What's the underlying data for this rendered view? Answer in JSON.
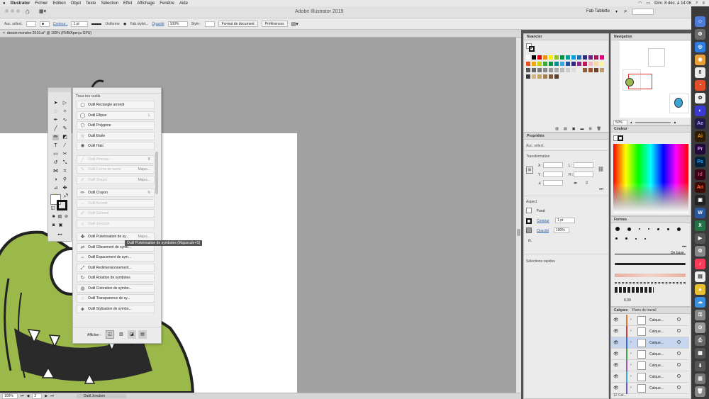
{
  "menubar": {
    "app": "Illustrator",
    "items": [
      "Fichier",
      "Edition",
      "Objet",
      "Texte",
      "Sélection",
      "Effet",
      "Affichage",
      "Fenêtre",
      "Aide"
    ],
    "datetime": "Dim. 8 déc. à 14:06"
  },
  "appbar": {
    "title": "Adobe Illustrator 2019",
    "workspace": "Fab Tablette"
  },
  "controlbar": {
    "selection_label": "Auc. sélect.",
    "stroke_label": "Contour :",
    "stroke_value": "1 pt",
    "stroke_profile": "Uniforme",
    "brush": "Fab.stylet...",
    "opacity_label": "Opacité",
    "opacity_value": "100%",
    "style_label": "Style :",
    "doc_format_btn": "Format de document",
    "prefs_btn": "Préférences"
  },
  "document": {
    "tab_title": "dessin-monstre-2019.ai* @ 100% (RVB/Aperçu GPU)"
  },
  "statusbar": {
    "zoom": "100%",
    "artboard": "2",
    "tool": "Outil Jonction"
  },
  "alltools": {
    "title": "Tous les outils",
    "items": [
      {
        "label": "Outil Rectangle arrondi",
        "shortcut": "",
        "icon": "rounded-rect",
        "dim": false
      },
      {
        "label": "Outil Ellipse",
        "shortcut": "L",
        "icon": "ellipse",
        "dim": false
      },
      {
        "label": "Outil Polygone",
        "shortcut": "",
        "icon": "polygon",
        "dim": false
      },
      {
        "label": "Outil Etoile",
        "shortcut": "",
        "icon": "star",
        "dim": false
      },
      {
        "label": "Outil Halo",
        "shortcut": "",
        "icon": "flare",
        "dim": false
      },
      {
        "label": "Outil Pinceau",
        "shortcut": "B",
        "icon": "brush",
        "dim": true
      },
      {
        "label": "Outil Forme de tache",
        "shortcut": "Majus...",
        "icon": "blob-brush",
        "dim": true
      },
      {
        "label": "Outil Shaper",
        "shortcut": "Majus...",
        "icon": "shaper",
        "dim": true
      },
      {
        "label": "Outil Crayon",
        "shortcut": "N",
        "icon": "pencil",
        "dim": false
      },
      {
        "label": "Outil Arrondi",
        "shortcut": "",
        "icon": "smooth",
        "dim": true
      },
      {
        "label": "Outil Gomme",
        "shortcut": "",
        "icon": "path-eraser",
        "dim": true
      },
      {
        "label": "Outil Jonction",
        "shortcut": "",
        "icon": "join",
        "dim": true
      },
      {
        "label": "Outil Pulvérisation de sy...",
        "shortcut": "Majus...",
        "icon": "symbol-sprayer",
        "dim": false
      },
      {
        "label": "Outil Glissement de symb...",
        "shortcut": "",
        "icon": "symbol-shifter",
        "dim": false
      },
      {
        "label": "Outil Espacement de sym...",
        "shortcut": "",
        "icon": "symbol-scruncher",
        "dim": false
      },
      {
        "label": "Outil Redimensionnement...",
        "shortcut": "",
        "icon": "symbol-sizer",
        "dim": false
      },
      {
        "label": "Outil Rotation de symboles",
        "shortcut": "",
        "icon": "symbol-spinner",
        "dim": false
      },
      {
        "label": "Outil Coloration de symbo...",
        "shortcut": "",
        "icon": "symbol-stainer",
        "dim": false
      },
      {
        "label": "Outil Transparence de sy...",
        "shortcut": "",
        "icon": "symbol-screener",
        "dim": false
      },
      {
        "label": "Outil Stylisation de symbo...",
        "shortcut": "",
        "icon": "symbol-styler",
        "dim": false
      }
    ],
    "footer_label": "Afficher :",
    "tooltip": "Outil Pulvérisation de symboles (Majuscule+S)"
  },
  "panels": {
    "swatches": {
      "title": "Nuancier"
    },
    "properties": {
      "title": "Propriétés",
      "selection": "Auc. sélect.",
      "transform_title": "Transformation",
      "x_label": "X :",
      "y_label": "Y :",
      "w_label": "L :",
      "h_label": "H :",
      "appearance_title": "Aspect",
      "fill_label": "Fond",
      "stroke_label": "Contour",
      "stroke_value": "1 pt",
      "opacity_label": "Opacité",
      "opacity_value": "100%",
      "fx_label": "fx.",
      "quick_actions": "Sélections rapides"
    },
    "navigator": {
      "title": "Navigation",
      "zoom": "50%"
    },
    "color": {
      "title": "Couleur"
    },
    "brushes": {
      "title": "Formes",
      "basic_label": "De base",
      "size_value": "6,00"
    },
    "layers": {
      "tabs": [
        "Calques",
        "Plans de travail"
      ],
      "rows": [
        "Calque...",
        "Calque...",
        "Calque...",
        "Calque...",
        "Calque...",
        "Calque...",
        "Calque..."
      ],
      "footer": "12 Cal..."
    }
  },
  "colors": {
    "monster_green": "#9bb84a",
    "ui_gray": "#a0a0a0",
    "accent_selection": "#c5d6ee"
  }
}
